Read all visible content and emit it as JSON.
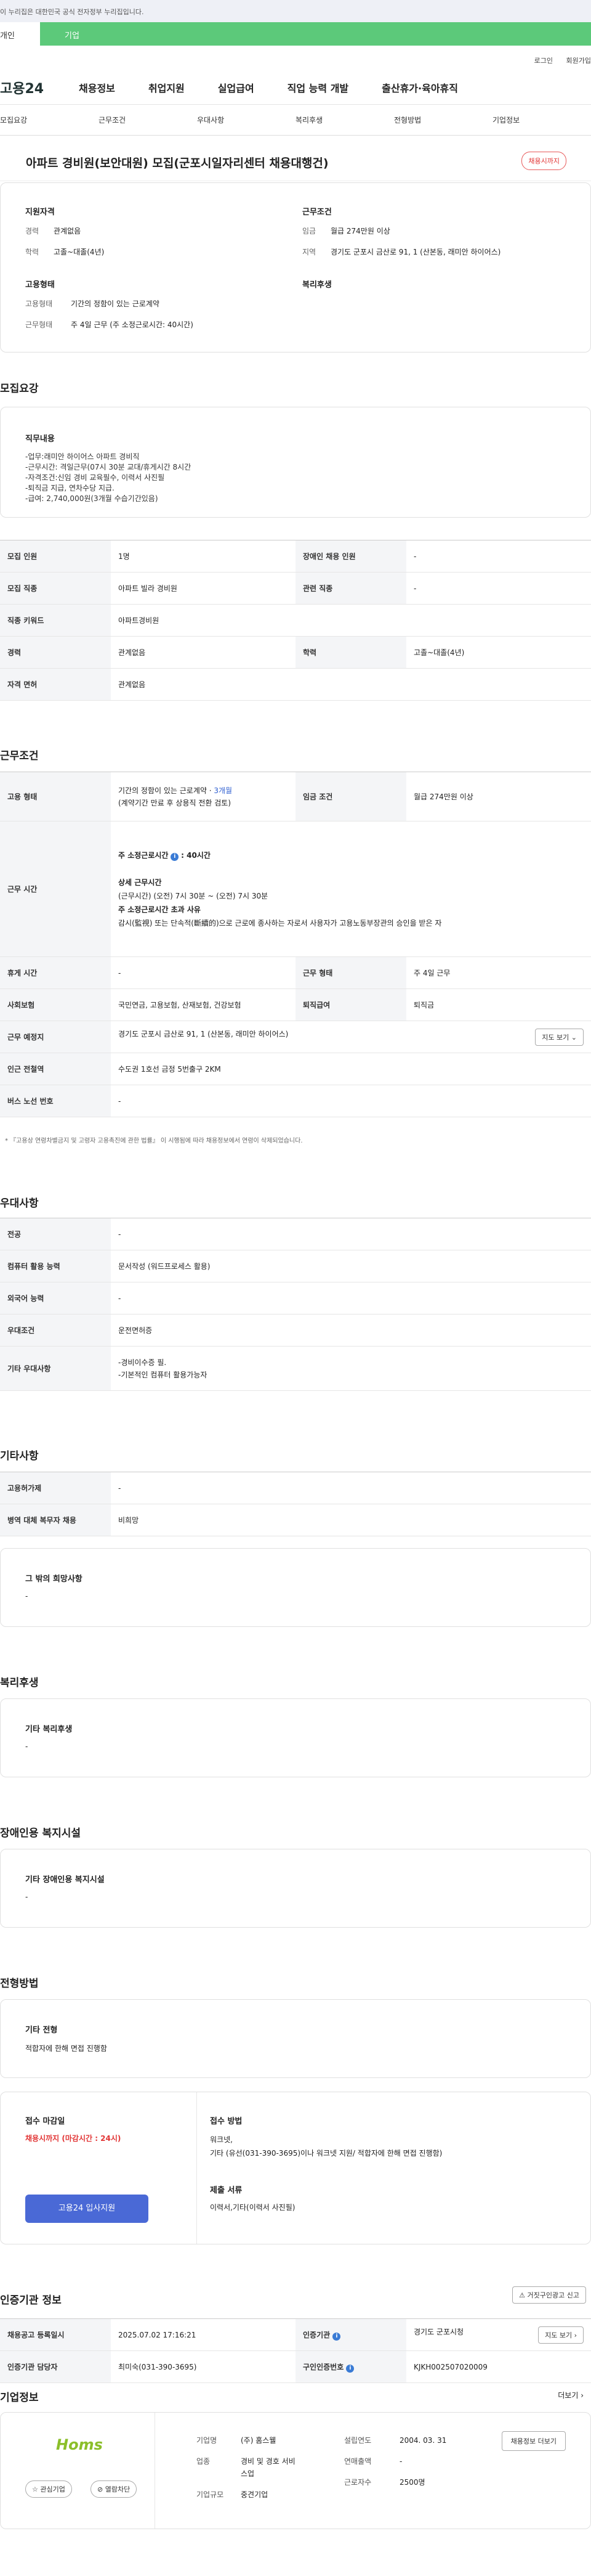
{
  "gov_bar": "이 누리집은 대한민국 공식 전자정부 누리집입니다.",
  "tabs": [
    "개인",
    "기업"
  ],
  "util": [
    "로그인",
    "회원가입"
  ],
  "logo": "고용24",
  "gnb": [
    "채용정보",
    "취업지원",
    "실업급여",
    "직업 능력 개발",
    "출산휴가·육아휴직"
  ],
  "subnav": [
    "모집요강",
    "근무조건",
    "우대사항",
    "복리후생",
    "전형방법",
    "기업정보"
  ],
  "job_title": "아파트 경비원(보안대원) 모집(군포시일자리센터 채용대행건)",
  "badge": "채용시까지",
  "summary": {
    "qual_title": "지원자격",
    "cond_title": "근무조건",
    "emp_title": "고용형태",
    "welfare_title": "복리후생",
    "career_k": "경력",
    "career_v": "관계없음",
    "edu_k": "학력",
    "edu_v": "고졸~대졸(4년)",
    "wage_k": "임금",
    "wage_v": "월급 274만원 이상",
    "region_k": "지역",
    "region_v": "경기도 군포시 금산로 91, 1 (산본동, 래미안 하이어스)",
    "type_k": "고용형태",
    "type_v": "기간의 정함이 있는 근로계약",
    "work_k": "근무형태",
    "work_v": "주 4일 근무 (주 소정근로시간: 40시간)"
  },
  "sec": {
    "recruit": "모집요강",
    "cond": "근무조건",
    "pref": "우대사항",
    "etc": "기타사항",
    "welfare": "복리후생",
    "disab": "장애인용 복지시설",
    "proc": "전형방법",
    "cert": "인증기관 정보",
    "company": "기업정보"
  },
  "duty_title": "직무내용",
  "duty_lines": [
    "-업무:래미안 하이어스 아파트 경비직",
    "-근무시간: 격일근무(07시 30분 교대/휴게시간 8시간",
    "-자격조건:신임 경비 교육필수, 이력서 사진필",
    "-퇴직금 지급, 연차수당 지급.",
    "-급여: 2,740,000원(3개월 수습기간있음)"
  ],
  "recruit_rows": {
    "people_k": "모집 인원",
    "people_v": "1명",
    "disab_k": "장애인 채용 인원",
    "disab_v": "-",
    "job_k": "모집 직종",
    "job_v": "아파트 빌라 경비원",
    "rel_k": "관련 직종",
    "rel_v": "-",
    "kw_k": "직종 키워드",
    "kw_v": "아파트경비원",
    "career_k": "경력",
    "career_v": "관계없음",
    "edu_k": "학력",
    "edu_v": "고졸~대졸(4년)",
    "lic_k": "자격 면허",
    "lic_v": "관계없음"
  },
  "cond_rows": {
    "emp_k": "고용 형태",
    "emp_v1a": "기간의 정함이 있는 근로계약 · ",
    "emp_v1b": "3개월",
    "emp_v2": "(계약기간 만료 후 상용직 전환 검토)",
    "wage_k": "임금 조건",
    "wage_v": "월급 274만원 이상",
    "hours_k": "근무 시간",
    "hours_l1": "주 소정근로시간",
    "hours_l1b": ": 40시간",
    "hours_l2": "상세 근무시간",
    "hours_l3": "(근무시간) (오전) 7시 30분 ~ (오전) 7시 30분",
    "hours_l4": "주 소정근로시간 초과 사유",
    "hours_l5": "감시(監視) 또는 단속적(斷續的)으로 근로에 종사하는 자로서 사용자가 고용노동부장관의 승인을 받은 자",
    "rest_k": "휴게 시간",
    "rest_v": "-",
    "form_k": "근무 형태",
    "form_v": "주 4일 근무",
    "ins_k": "사회보험",
    "ins_v": "국민연금, 고용보험, 산재보험, 건강보험",
    "ret_k": "퇴직급여",
    "ret_v": "퇴직금",
    "place_k": "근무 예정지",
    "place_v": "경기도 군포시 금산로 91, 1 (산본동, 래미안 하이어스)",
    "map_btn": "지도 보기",
    "sub_k": "인근 전철역",
    "sub_v": "수도권 1호선 금정 5번출구 2KM",
    "bus_k": "버스 노선 번호",
    "bus_v": "-",
    "note": "* 『고용상 연령차별금지 및 고령자 고용촉진에 관한 법률』 이 시행됨에 따라 채용정보에서 연령이 삭제되었습니다."
  },
  "pref_rows": {
    "major_k": "전공",
    "major_v": "-",
    "pc_k": "컴퓨터 활용 능력",
    "pc_v": "문서작성 (워드프로세스 활용)",
    "lang_k": "외국어 능력",
    "lang_v": "-",
    "pcond_k": "우대조건",
    "pcond_v": "운전면허증",
    "other_k": "기타 우대사항",
    "other_v1": "-경비이수증 필.",
    "other_v2": "-기본적인 컴퓨터 활용가능자"
  },
  "etc_rows": {
    "emp_k": "고용허가제",
    "emp_v": "-",
    "mil_k": "병역 대체 복무자 채용",
    "mil_v": "비희망",
    "hope_t": "그 밖의 희망사항",
    "hope_v": "-"
  },
  "welfare_box": {
    "t": "기타 복리후생",
    "v": "-"
  },
  "disab_box": {
    "t": "기타 장애인용 복지시설",
    "v": "-"
  },
  "proc_box": {
    "t": "기타 전형",
    "v": "적합자에 한해 면접 진행함"
  },
  "apply": {
    "deadline_t": "접수 마감일",
    "deadline_v": "채용시까지 (마감시간 : 24시)",
    "btn": "고용24 입사지원",
    "method_t": "접수 방법",
    "method_v1": "워크넷,",
    "method_v2": "기타 (유선(031-390-3695)이나 워크넷 지원/ 적합자에 한해 면접 진행함)",
    "docs_t": "제출 서류",
    "docs_v": "이력서,기타(이력서 사진필)"
  },
  "cert": {
    "report_btn": "거짓구인광고 신고",
    "reg_k": "채용공고 등록일시",
    "reg_v": "2025.07.02 17:16:21",
    "org_k": "인증기관",
    "org_v": "경기도 군포시청",
    "map_btn": "지도 보기",
    "mgr_k": "인증기관 담당자",
    "mgr_v": "최미숙(031-390-3695)",
    "no_k": "구인인증번호",
    "no_v": "KJKH002507020009"
  },
  "company": {
    "more": "더보기",
    "logo_text": "Homs",
    "interest": "관심기업",
    "follow": "열람차단",
    "name_k": "기업명",
    "name_v": "(주) 홈스웰",
    "ind_k": "업종",
    "ind_v1": "경비 및 경호 서비",
    "ind_v2": "스업",
    "size_k": "기업규모",
    "size_v": "중견기업",
    "est_k": "설립연도",
    "est_v": "2004. 03. 31",
    "sales_k": "연매출액",
    "sales_v": "-",
    "emp_k": "근로자수",
    "emp_v": "2500명",
    "hire_btn": "채용정보 더보기"
  }
}
